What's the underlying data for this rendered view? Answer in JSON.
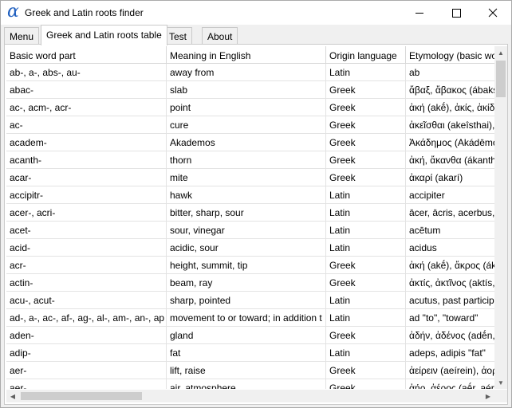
{
  "window": {
    "title": "Greek and Latin roots finder",
    "icon": "alpha-icon",
    "icon_glyph": "α"
  },
  "tabs": [
    {
      "label": "Menu",
      "active": false
    },
    {
      "label": "Greek and Latin roots table",
      "active": true
    },
    {
      "label": "Test",
      "active": false
    },
    {
      "label": "About",
      "active": false
    }
  ],
  "table": {
    "columns": [
      "Basic word part",
      "Meaning in English",
      "Origin language",
      "Etymology (basic wo"
    ],
    "rows": [
      [
        "ab-, a-, abs-, au-",
        "away from",
        "Latin",
        "ab"
      ],
      [
        "abac-",
        "slab",
        "Greek",
        "ἄβαξ, ἄβακος (ábaks"
      ],
      [
        "ac-, acm-, acr-",
        "point",
        "Greek",
        "ἀκή (akḗ), ἀκίς, ἀκίδ"
      ],
      [
        "ac-",
        "cure",
        "Greek",
        "ἀκεῖσθαι (akeîsthai),"
      ],
      [
        "academ-",
        "Akademos",
        "Greek",
        "Ἀκάδημος (Akádēmo"
      ],
      [
        "acanth-",
        "thorn",
        "Greek",
        "ἀκή, ἄκανθα (ákanth"
      ],
      [
        "acar-",
        "mite",
        "Greek",
        "ἀκαρί (akarí)"
      ],
      [
        "accipitr-",
        "hawk",
        "Latin",
        "accipiter"
      ],
      [
        "acer-, acri-",
        "bitter, sharp, sour",
        "Latin",
        "ācer, ācris, acerbus, a"
      ],
      [
        "acet-",
        "sour, vinegar",
        "Latin",
        "acētum"
      ],
      [
        "acid-",
        "acidic, sour",
        "Latin",
        "acidus"
      ],
      [
        "acr-",
        "height, summit, tip",
        "Greek",
        "ἀκή (akḗ), ἄκρος (ákr"
      ],
      [
        "actin-",
        "beam, ray",
        "Greek",
        "ἀκτίς, ἀκτῖνος (aktís,"
      ],
      [
        "acu-, acut-",
        "sharp, pointed",
        "Latin",
        "acutus, past participl"
      ],
      [
        "ad-, a-, ac-, af-, ag-, al-, am-, an-, ap",
        "movement to or toward; in addition t",
        "Latin",
        "ad \"to\", \"toward\""
      ],
      [
        "aden-",
        "gland",
        "Greek",
        "ἀδήν, ἀδένος (adḗn,"
      ],
      [
        "adip-",
        "fat",
        "Latin",
        "adeps, adipis \"fat\""
      ],
      [
        "aer-",
        "lift, raise",
        "Greek",
        "ἀείρειν (aeírein), ἀορ"
      ],
      [
        "aer-",
        "air, atmosphere",
        "Greek",
        "ἀήρ, ἀέρος (aḗr, aér"
      ]
    ]
  },
  "scrollbars": {
    "vertical": {
      "up_arrow": "▲",
      "down_arrow": "▼"
    },
    "horizontal": {
      "left_arrow": "◀",
      "right_arrow": "▶"
    }
  }
}
